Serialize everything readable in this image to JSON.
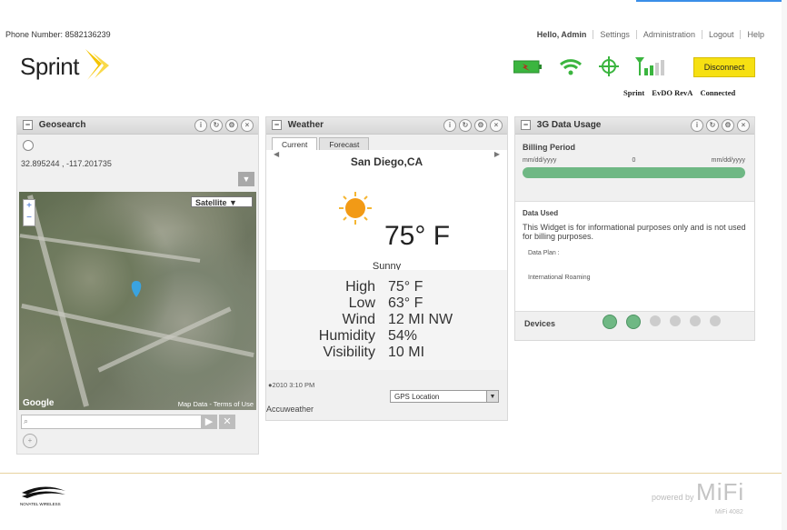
{
  "header": {
    "phone_label": "Phone Number:",
    "phone_value": "8582136239",
    "links": [
      "Hello, Admin",
      "Settings",
      "Administration",
      "Logout",
      "Help"
    ],
    "logo_text": "Sprint",
    "disconnect_label": "Disconnect",
    "conn": [
      "Sprint",
      "EvDO RevA",
      "Connected"
    ]
  },
  "geosearch": {
    "title": "Geosearch",
    "coords": "32.895244 , -117.201735",
    "map_type": "Satellite",
    "map_credit": "Map Data - Terms of Use",
    "google": "Google",
    "search_placeholder": ""
  },
  "weather": {
    "title": "Weather",
    "tabs": [
      "Current",
      "Forecast"
    ],
    "city": "San Diego,CA",
    "temp": "75° F",
    "condition": "Sunny",
    "rows": [
      {
        "k": "High",
        "v": "75° F"
      },
      {
        "k": "Low",
        "v": "63° F"
      },
      {
        "k": "Wind",
        "v": "12 MI NW"
      },
      {
        "k": "Humidity",
        "v": "54%"
      },
      {
        "k": "Visibility",
        "v": "10 MI"
      }
    ],
    "timestamp": "2010 3:10 PM",
    "source": "Accuweather",
    "gps_option": "GPS Location"
  },
  "data_usage": {
    "title": "3G Data Usage",
    "billing_label": "Billing Period",
    "start": "mm/dd/yyyy",
    "mid": "0",
    "end": "mm/dd/yyyy",
    "used_label": "Data Used",
    "note": "This Widget is for informational purposes only and is not used for billing purposes.",
    "plan_label": "Data Plan :",
    "roaming_label": "International Roaming",
    "devices_label": "Devices"
  },
  "footer": {
    "brand_small": "powered by",
    "brand_big": "MiFi",
    "model": "MiFi 4082",
    "left_logo": "NOVATEL WIRELESS"
  }
}
